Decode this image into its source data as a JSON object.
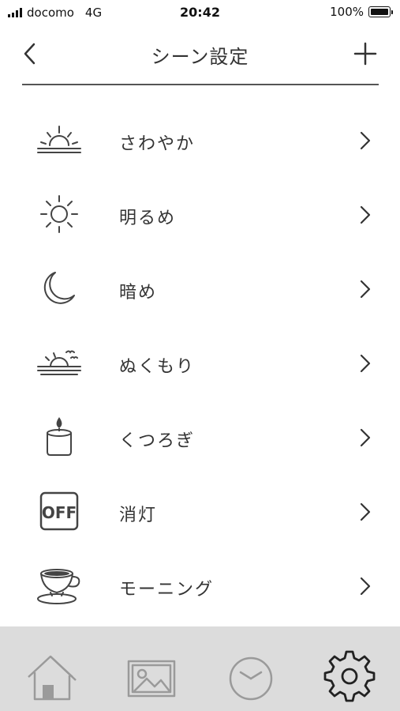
{
  "status_bar": {
    "carrier": "docomo",
    "network": "4G",
    "time": "20:42",
    "battery": "100%"
  },
  "header": {
    "title": "シーン設定",
    "back_icon": "chevron-left-icon",
    "add_icon": "plus-icon"
  },
  "scenes": [
    {
      "label": "さわやか",
      "icon": "sunrise-icon"
    },
    {
      "label": "明るめ",
      "icon": "sun-icon"
    },
    {
      "label": "暗め",
      "icon": "moon-icon"
    },
    {
      "label": "ぬくもり",
      "icon": "sunset-birds-icon"
    },
    {
      "label": "くつろぎ",
      "icon": "candle-icon"
    },
    {
      "label": "消灯",
      "icon": "off-icon"
    },
    {
      "label": "モーニング",
      "icon": "coffee-cup-icon"
    }
  ],
  "tabbar": {
    "tabs": [
      "home-icon",
      "image-icon",
      "clock-icon",
      "gear-icon"
    ],
    "active": "gear-icon"
  },
  "colors": {
    "icon_stroke": "#444444",
    "tab_inactive": "#9a9a9a",
    "tab_active": "#222222",
    "tabbar_bg": "#dcdcdc"
  }
}
